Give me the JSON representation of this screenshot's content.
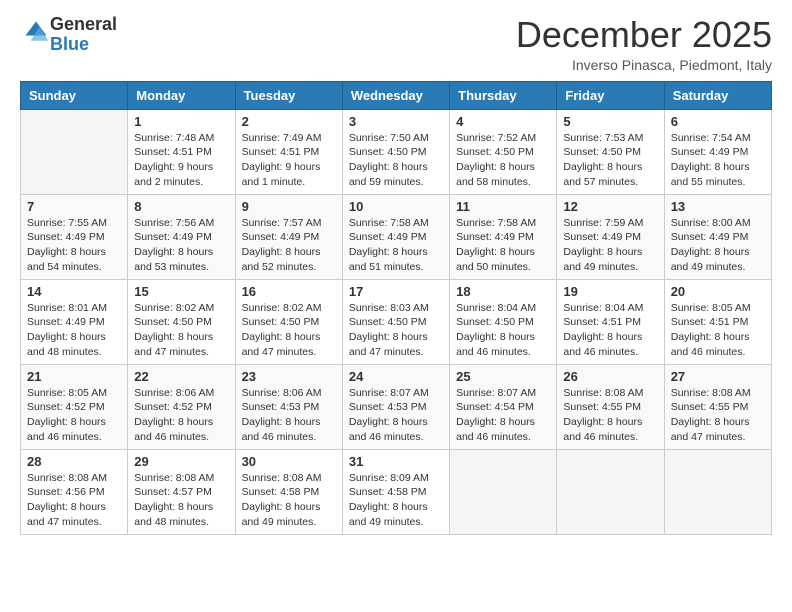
{
  "logo": {
    "general": "General",
    "blue": "Blue"
  },
  "header": {
    "month": "December 2025",
    "location": "Inverso Pinasca, Piedmont, Italy"
  },
  "days_of_week": [
    "Sunday",
    "Monday",
    "Tuesday",
    "Wednesday",
    "Thursday",
    "Friday",
    "Saturday"
  ],
  "weeks": [
    [
      {
        "day": "",
        "sunrise": "",
        "sunset": "",
        "daylight": ""
      },
      {
        "day": "1",
        "sunrise": "7:48 AM",
        "sunset": "4:51 PM",
        "daylight": "9 hours and 2 minutes."
      },
      {
        "day": "2",
        "sunrise": "7:49 AM",
        "sunset": "4:51 PM",
        "daylight": "9 hours and 1 minute."
      },
      {
        "day": "3",
        "sunrise": "7:50 AM",
        "sunset": "4:50 PM",
        "daylight": "8 hours and 59 minutes."
      },
      {
        "day": "4",
        "sunrise": "7:52 AM",
        "sunset": "4:50 PM",
        "daylight": "8 hours and 58 minutes."
      },
      {
        "day": "5",
        "sunrise": "7:53 AM",
        "sunset": "4:50 PM",
        "daylight": "8 hours and 57 minutes."
      },
      {
        "day": "6",
        "sunrise": "7:54 AM",
        "sunset": "4:49 PM",
        "daylight": "8 hours and 55 minutes."
      }
    ],
    [
      {
        "day": "7",
        "sunrise": "7:55 AM",
        "sunset": "4:49 PM",
        "daylight": "8 hours and 54 minutes."
      },
      {
        "day": "8",
        "sunrise": "7:56 AM",
        "sunset": "4:49 PM",
        "daylight": "8 hours and 53 minutes."
      },
      {
        "day": "9",
        "sunrise": "7:57 AM",
        "sunset": "4:49 PM",
        "daylight": "8 hours and 52 minutes."
      },
      {
        "day": "10",
        "sunrise": "7:58 AM",
        "sunset": "4:49 PM",
        "daylight": "8 hours and 51 minutes."
      },
      {
        "day": "11",
        "sunrise": "7:58 AM",
        "sunset": "4:49 PM",
        "daylight": "8 hours and 50 minutes."
      },
      {
        "day": "12",
        "sunrise": "7:59 AM",
        "sunset": "4:49 PM",
        "daylight": "8 hours and 49 minutes."
      },
      {
        "day": "13",
        "sunrise": "8:00 AM",
        "sunset": "4:49 PM",
        "daylight": "8 hours and 49 minutes."
      }
    ],
    [
      {
        "day": "14",
        "sunrise": "8:01 AM",
        "sunset": "4:49 PM",
        "daylight": "8 hours and 48 minutes."
      },
      {
        "day": "15",
        "sunrise": "8:02 AM",
        "sunset": "4:50 PM",
        "daylight": "8 hours and 47 minutes."
      },
      {
        "day": "16",
        "sunrise": "8:02 AM",
        "sunset": "4:50 PM",
        "daylight": "8 hours and 47 minutes."
      },
      {
        "day": "17",
        "sunrise": "8:03 AM",
        "sunset": "4:50 PM",
        "daylight": "8 hours and 47 minutes."
      },
      {
        "day": "18",
        "sunrise": "8:04 AM",
        "sunset": "4:50 PM",
        "daylight": "8 hours and 46 minutes."
      },
      {
        "day": "19",
        "sunrise": "8:04 AM",
        "sunset": "4:51 PM",
        "daylight": "8 hours and 46 minutes."
      },
      {
        "day": "20",
        "sunrise": "8:05 AM",
        "sunset": "4:51 PM",
        "daylight": "8 hours and 46 minutes."
      }
    ],
    [
      {
        "day": "21",
        "sunrise": "8:05 AM",
        "sunset": "4:52 PM",
        "daylight": "8 hours and 46 minutes."
      },
      {
        "day": "22",
        "sunrise": "8:06 AM",
        "sunset": "4:52 PM",
        "daylight": "8 hours and 46 minutes."
      },
      {
        "day": "23",
        "sunrise": "8:06 AM",
        "sunset": "4:53 PM",
        "daylight": "8 hours and 46 minutes."
      },
      {
        "day": "24",
        "sunrise": "8:07 AM",
        "sunset": "4:53 PM",
        "daylight": "8 hours and 46 minutes."
      },
      {
        "day": "25",
        "sunrise": "8:07 AM",
        "sunset": "4:54 PM",
        "daylight": "8 hours and 46 minutes."
      },
      {
        "day": "26",
        "sunrise": "8:08 AM",
        "sunset": "4:55 PM",
        "daylight": "8 hours and 46 minutes."
      },
      {
        "day": "27",
        "sunrise": "8:08 AM",
        "sunset": "4:55 PM",
        "daylight": "8 hours and 47 minutes."
      }
    ],
    [
      {
        "day": "28",
        "sunrise": "8:08 AM",
        "sunset": "4:56 PM",
        "daylight": "8 hours and 47 minutes."
      },
      {
        "day": "29",
        "sunrise": "8:08 AM",
        "sunset": "4:57 PM",
        "daylight": "8 hours and 48 minutes."
      },
      {
        "day": "30",
        "sunrise": "8:08 AM",
        "sunset": "4:58 PM",
        "daylight": "8 hours and 49 minutes."
      },
      {
        "day": "31",
        "sunrise": "8:09 AM",
        "sunset": "4:58 PM",
        "daylight": "8 hours and 49 minutes."
      },
      {
        "day": "",
        "sunrise": "",
        "sunset": "",
        "daylight": ""
      },
      {
        "day": "",
        "sunrise": "",
        "sunset": "",
        "daylight": ""
      },
      {
        "day": "",
        "sunrise": "",
        "sunset": "",
        "daylight": ""
      }
    ]
  ],
  "labels": {
    "sunrise_prefix": "Sunrise: ",
    "sunset_prefix": "Sunset: ",
    "daylight_prefix": "Daylight: "
  }
}
